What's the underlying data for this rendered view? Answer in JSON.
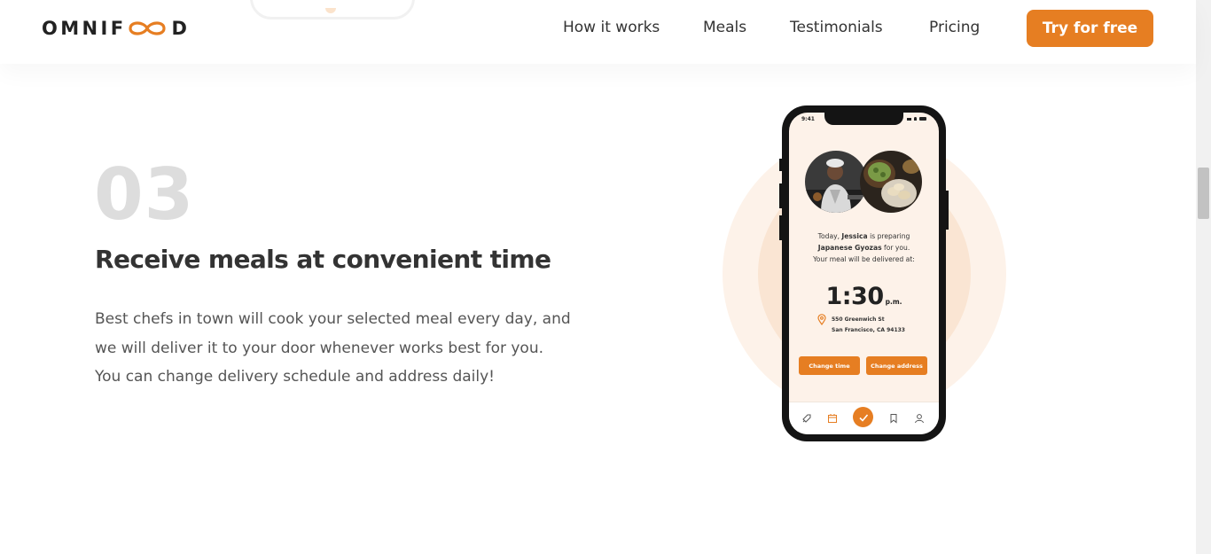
{
  "header": {
    "logo_text_left": "OMNIF",
    "logo_text_right": "D",
    "nav": [
      {
        "label": "How it works"
      },
      {
        "label": "Meals"
      },
      {
        "label": "Testimonials"
      },
      {
        "label": "Pricing"
      }
    ],
    "cta_label": "Try for free"
  },
  "step": {
    "number": "03",
    "title": "Receive meals at convenient time",
    "description": "Best chefs in town will cook your selected meal every day, and we will deliver it to your door whenever works best for you. You can change delivery schedule and address daily!"
  },
  "phone": {
    "status_time": "9:41",
    "line1_pre": "Today, ",
    "line1_name": "Jessica",
    "line1_post": " is preparing",
    "line2_meal": "Japanese Gyozas",
    "line2_post": " for you.",
    "line3": "Your meal will be delivered at:",
    "delivery_time": "1:30",
    "delivery_period": "p.m.",
    "address_line1": "550 Greenwich St",
    "address_line2": "San Francisco, CA 94133",
    "change_time_label": "Change time",
    "change_address_label": "Change address",
    "tabs": [
      "rocket-icon",
      "calendar-icon",
      "check-icon",
      "bookmark-icon",
      "user-icon"
    ]
  },
  "colors": {
    "accent": "#e67e22",
    "accent_light": "#fdf2e9",
    "accent_tint": "#fae5d3",
    "step_number": "#dddddd",
    "heading": "#333333",
    "body_text": "#555555"
  }
}
